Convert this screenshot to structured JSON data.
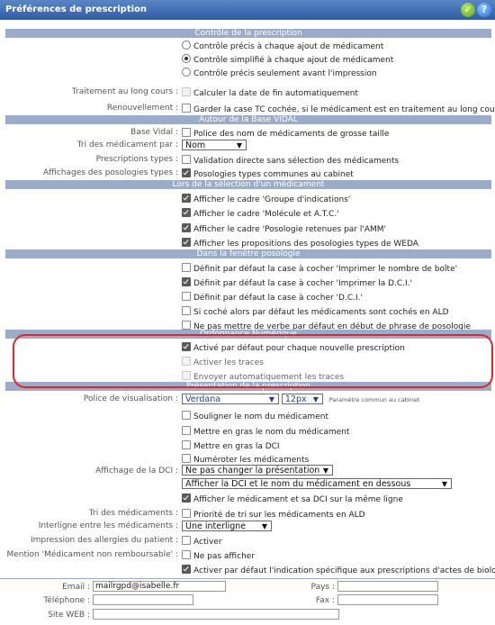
{
  "window": {
    "title": "Préférences de prescription"
  },
  "sections": {
    "controle": "Contrôle de la prescription",
    "base": "Autour de la Base VIDAL",
    "selection": "Lors de la sélection d'un médicament",
    "fenetre": "Dans la fenêtre posologie",
    "ordonnance": "Ordonnance Numérique",
    "presentation": "Présentation de la prescription"
  },
  "controle": {
    "radios": [
      "Contrôle précis à chaque ajout de médicament",
      "Contrôle simplifié à chaque ajout de médicament",
      "Contrôle précis seulement avant l'impression"
    ],
    "selected_index": 1,
    "traitement_label": "Traitement au long cours :",
    "traitement_value": "Calculer la date de fin automatiquement",
    "renouvellement_label": "Renouvellement :",
    "renouvellement_value": "Garder la case TC cochée, si le médicament est en traitement au long cours"
  },
  "base": {
    "base_vidal_label": "Base Vidal :",
    "base_vidal_value": "Police des nom de médicaments de grosse taille",
    "tri_label": "Tri des médicament par :",
    "tri_value": "Nom",
    "prescriptions_label": "Prescriptions types :",
    "prescriptions_value": "Validation directe sans sélection des médicaments",
    "affichages_label": "Affichages des posologies types :",
    "affichages_value": "Posologies types communes au cabinet"
  },
  "selection": {
    "items": [
      "Afficher le cadre 'Groupe d'indications'",
      "Afficher le cadre 'Molécule et A.T.C.'",
      "Afficher le cadre 'Posologie retenues par l'AMM'",
      "Afficher les propositions des posologies types de WEDA"
    ]
  },
  "fenetre": {
    "items": [
      "Définit par défaut la case à cocher 'Imprimer le nombre de boîte'",
      "Définit par défaut la case à cocher 'Imprimer la D.C.I.'",
      "Définit par défaut la case à cocher 'D.C.I.'",
      "Si coché alors par défaut les médicaments sont cochés en ALD",
      "Ne pas mettre de verbe par défaut en début de phrase de posologie"
    ]
  },
  "ordonnance": {
    "items": [
      "Activé par défaut pour chaque nouvelle prescription",
      "Activer les traces",
      "Envoyer automatiquement les traces"
    ]
  },
  "presentation": {
    "police_label": "Police de visualisation :",
    "font_value": "Verdana",
    "size_value": "12px",
    "police_note": "Paramètre commun au cabinet",
    "options": [
      "Souligner le nom du médicament",
      "Mettre en gras le nom du médicament",
      "Mettre en gras la DCI",
      "Numéroter les médicaments"
    ],
    "dci_label": "Affichage de la DCI :",
    "dci_select1": "Ne pas changer la présentation",
    "dci_select2": "Afficher la DCI et le nom du médicament en dessous",
    "dci_check": "Afficher le médicament et sa DCI sur la même ligne",
    "tri_label": "Tri des médicaments :",
    "tri_value": "Priorité de tri sur les médicaments en ALD",
    "interligne_label": "Interligne entre les médicaments :",
    "interligne_value": "Une interligne",
    "allergies_label": "Impression des allergies du patient :",
    "allergies_value": "Activer",
    "mention_label": "Mention 'Médicament non remboursable' :",
    "mention_value": "Ne pas afficher",
    "actes_value": "Activer par défaut l'indication spécifique aux prescriptions d'actes de biologie"
  },
  "contact": {
    "email_label": "Email :",
    "email_value": "mailrgpd@isabelle.fr",
    "pays_label": "Pays :",
    "pays_value": "",
    "telephone_label": "Téléphone :",
    "telephone_value": "",
    "fax_label": "Fax :",
    "fax_value": "",
    "site_label": "Site WEB :",
    "site_value": ""
  }
}
